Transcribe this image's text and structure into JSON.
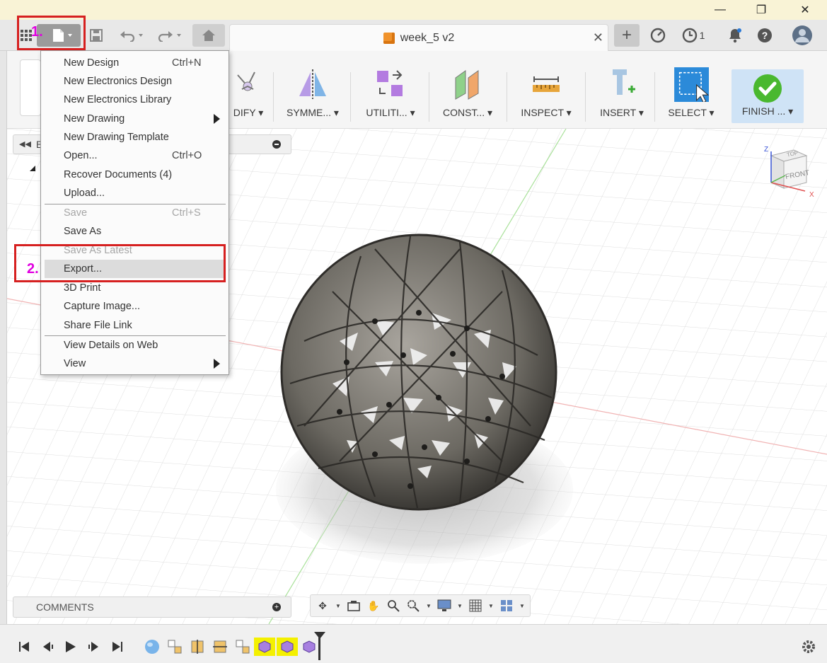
{
  "titlebar": {
    "minimize": "—",
    "restore": "❐",
    "close": "✕"
  },
  "tabs": {
    "document_title": "week_5 v2",
    "close_symbol": "✕",
    "new_tab_symbol": "+",
    "job_count": "1"
  },
  "ribbon": {
    "groups": [
      {
        "label": "DIFY ▾"
      },
      {
        "label": "SYMME... ▾"
      },
      {
        "label": "UTILITI... ▾"
      },
      {
        "label": "CONST... ▾"
      },
      {
        "label": "INSPECT ▾"
      },
      {
        "label": "INSERT ▾"
      },
      {
        "label": "SELECT ▾"
      },
      {
        "label": "FINISH ... ▾"
      }
    ]
  },
  "file_menu": {
    "items": [
      {
        "label": "New Design",
        "shortcut": "Ctrl+N"
      },
      {
        "label": "New Electronics Design",
        "shortcut": ""
      },
      {
        "label": "New Electronics Library",
        "shortcut": ""
      },
      {
        "label": "New Drawing",
        "shortcut": ""
      },
      {
        "label": "New Drawing Template",
        "shortcut": ""
      },
      {
        "label": "Open...",
        "shortcut": "Ctrl+O"
      },
      {
        "label": "Recover Documents (4)",
        "shortcut": ""
      },
      {
        "label": "Upload...",
        "shortcut": ""
      },
      {
        "label": "Save",
        "shortcut": "Ctrl+S"
      },
      {
        "label": "Save As",
        "shortcut": ""
      },
      {
        "label": "Save As Latest",
        "shortcut": ""
      },
      {
        "label": "Export...",
        "shortcut": ""
      },
      {
        "label": "3D Print",
        "shortcut": ""
      },
      {
        "label": "Capture Image...",
        "shortcut": ""
      },
      {
        "label": "Share File Link",
        "shortcut": ""
      },
      {
        "label": "View Details on Web",
        "shortcut": ""
      },
      {
        "label": "View",
        "shortcut": ""
      }
    ]
  },
  "browser": {
    "label": "B"
  },
  "comments": {
    "label": "COMMENTS"
  },
  "viewcube": {
    "top": "TOP",
    "front": "FRONT",
    "axis_z": "Z",
    "axis_x": "X"
  },
  "annotations": {
    "step1": "1.",
    "step2": "2."
  },
  "colors": {
    "highlight_box": "#d62020",
    "annotation_text": "#e000e0",
    "timeline_highlight": "#f4f000"
  }
}
